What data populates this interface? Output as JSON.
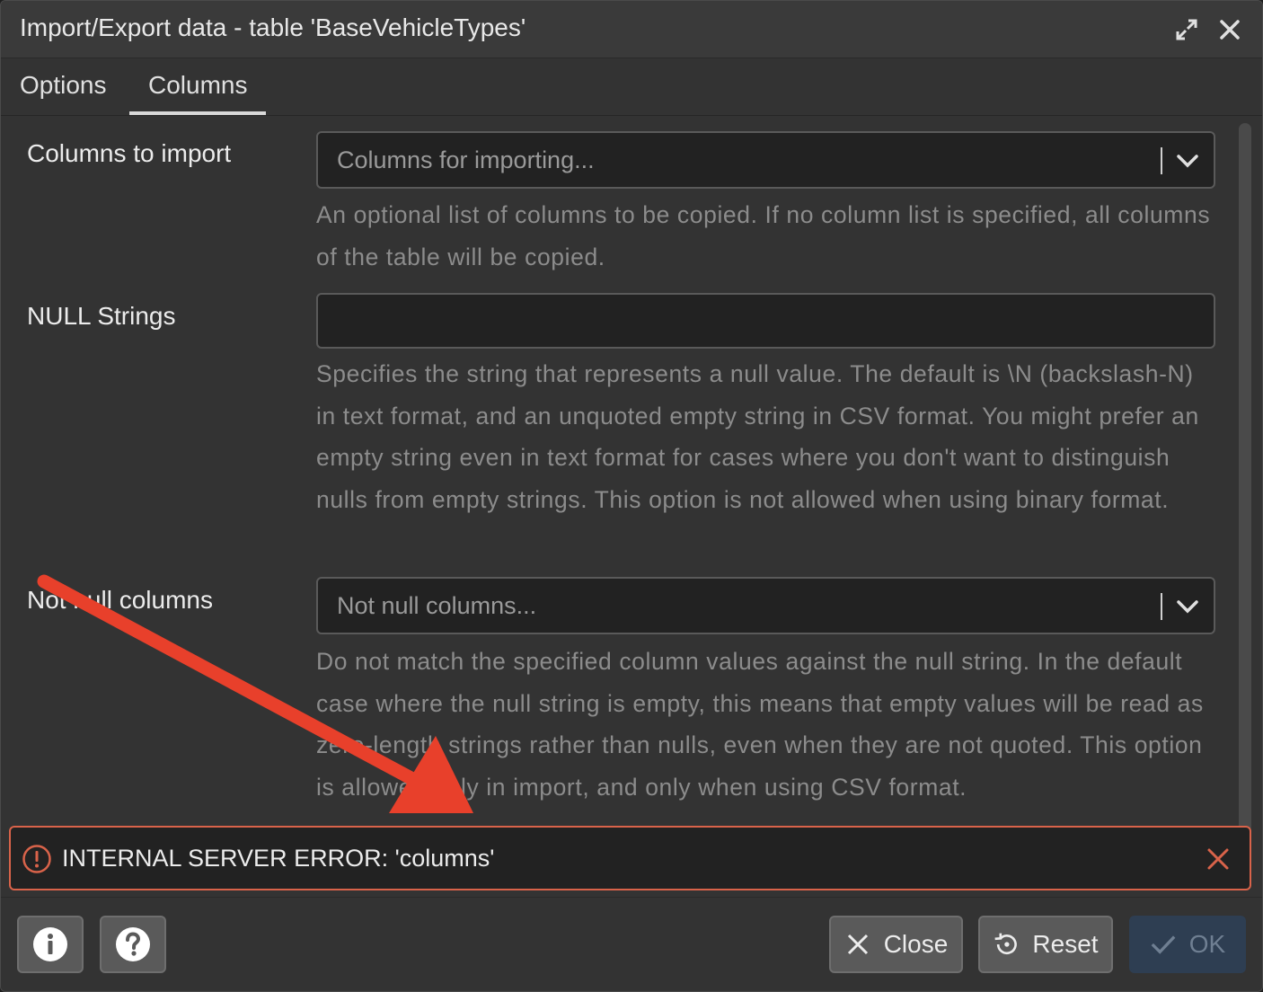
{
  "dialog": {
    "title": "Import/Export data - table 'BaseVehicleTypes'"
  },
  "tabs": [
    {
      "label": "Options",
      "active": false
    },
    {
      "label": "Columns",
      "active": true
    }
  ],
  "fields": {
    "columns_to_import": {
      "label": "Columns to import",
      "placeholder": "Columns for importing...",
      "help": "An optional list of columns to be copied. If no column list is specified, all columns of the table will be copied."
    },
    "null_strings": {
      "label": "NULL Strings",
      "value": "",
      "help": "Specifies the string that represents a null value. The default is \\N (backslash-N) in text format, and an unquoted empty string in CSV format. You might prefer an empty string even in text format for cases where you don't want to distinguish nulls from empty strings. This option is not allowed when using binary format."
    },
    "not_null_columns": {
      "label": "Not null columns",
      "placeholder": "Not null columns...",
      "help": "Do not match the specified column values against the null string. In the default case where the null string is empty, this means that empty values will be read as zero-length strings rather than nulls, even when they are not quoted. This option is allowed only in import, and only when using CSV format."
    }
  },
  "error": {
    "message": "INTERNAL SERVER ERROR: 'columns'",
    "color": "#d9634a"
  },
  "footer": {
    "close_label": "Close",
    "reset_label": "Reset",
    "ok_label": "OK"
  },
  "annotation": {
    "arrow_color": "#e8402b"
  }
}
